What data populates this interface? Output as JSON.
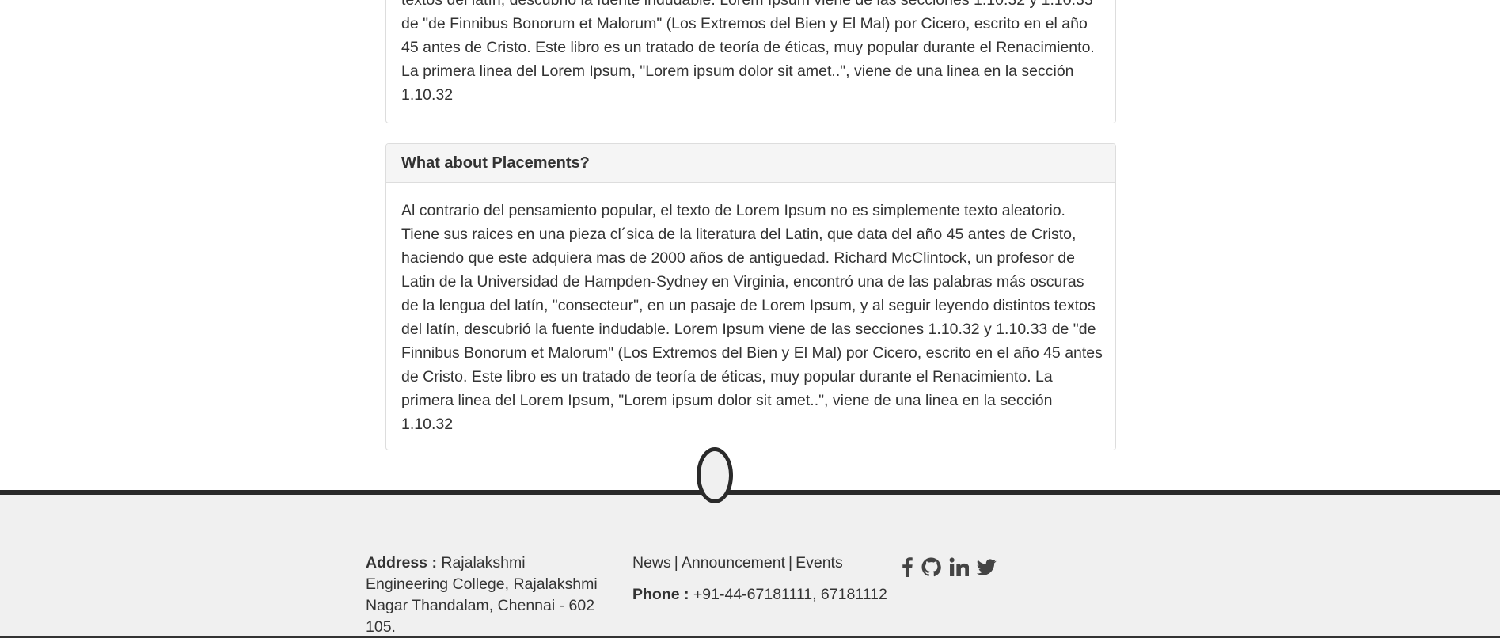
{
  "panels": [
    {
      "body": "textos del latín, descubrió la fuente indudable. Lorem Ipsum viene de las secciones 1.10.32 y 1.10.33 de \"de Finnibus Bonorum et Malorum\" (Los Extremos del Bien y El Mal) por Cicero, escrito en el año 45 antes de Cristo. Este libro es un tratado de teoría de éticas, muy popular durante el Renacimiento. La primera linea del Lorem Ipsum, \"Lorem ipsum dolor sit amet..\", viene de una linea en la sección 1.10.32"
    },
    {
      "heading": "What about Placements?",
      "body": "Al contrario del pensamiento popular, el texto de Lorem Ipsum no es simplemente texto aleatorio. Tiene sus raices en una pieza cl´sica de la literatura del Latin, que data del año 45 antes de Cristo, haciendo que este adquiera mas de 2000 años de antiguedad. Richard McClintock, un profesor de Latin de la Universidad de Hampden-Sydney en Virginia, encontró una de las palabras más oscuras de la lengua del latín, \"consecteur\", en un pasaje de Lorem Ipsum, y al seguir leyendo distintos textos del latín, descubrió la fuente indudable. Lorem Ipsum viene de las secciones 1.10.32 y 1.10.33 de \"de Finnibus Bonorum et Malorum\" (Los Extremos del Bien y El Mal) por Cicero, escrito en el año 45 antes de Cristo. Este libro es un tratado de teoría de éticas, muy popular durante el Renacimiento. La primera linea del Lorem Ipsum, \"Lorem ipsum dolor sit amet..\", viene de una linea en la sección 1.10.32"
    }
  ],
  "footer": {
    "address_label": "Address :",
    "address_text": "Rajalakshmi Engineering College, Rajalakshmi Nagar Thandalam, Chennai - 602 105.",
    "links": [
      "News",
      "Announcement",
      "Events"
    ],
    "separator": "|",
    "phone_label": "Phone :",
    "phone_text": "+91-44-67181111, 67181112",
    "social_icons": [
      "facebook-icon",
      "github-icon",
      "linkedin-icon",
      "twitter-icon"
    ],
    "accent_color": "#2a2a2a",
    "background_color": "#f0f0f0"
  }
}
